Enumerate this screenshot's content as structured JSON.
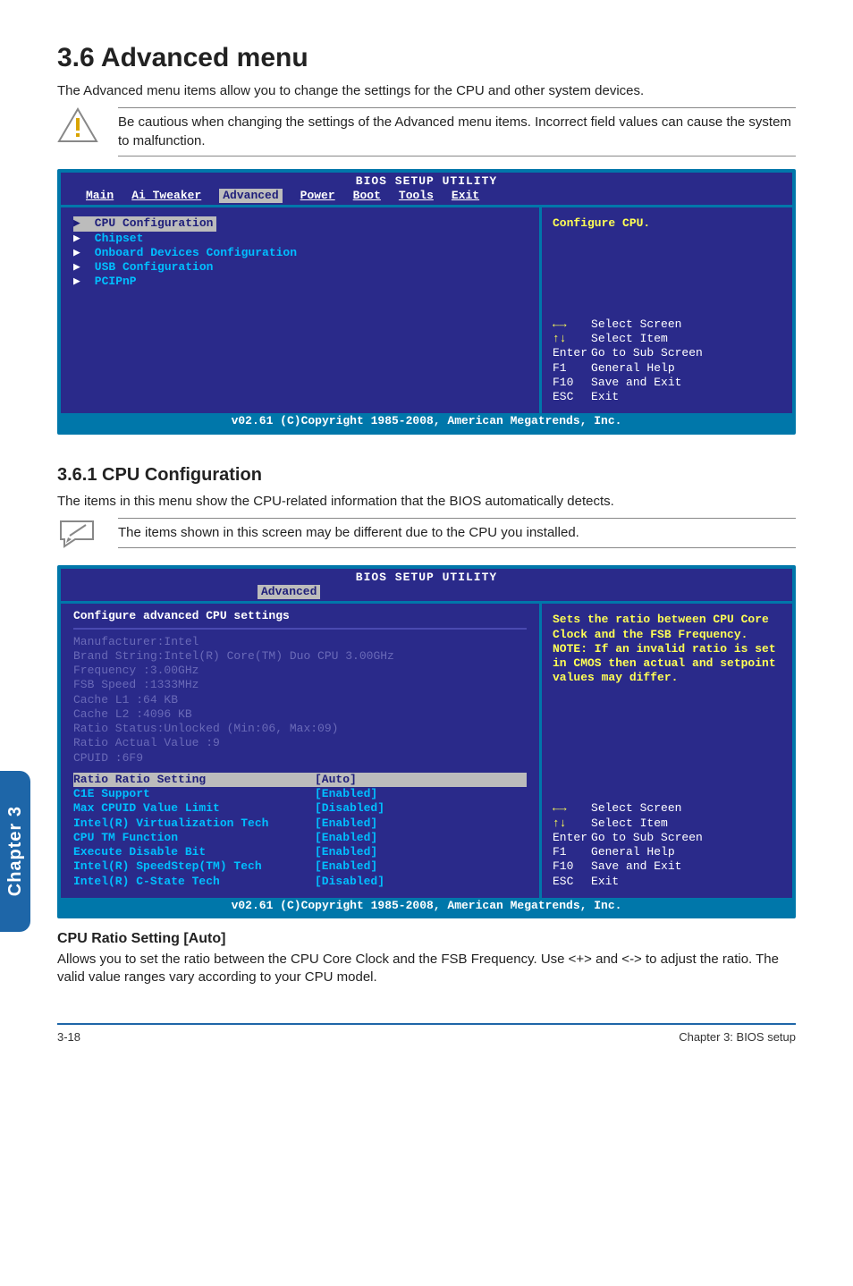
{
  "heading": {
    "number_title": "3.6     Advanced menu",
    "intro": "The Advanced menu items allow you to change the settings for the CPU and other system devices.",
    "caution": "Be cautious when changing the settings of the Advanced menu items. Incorrect field values can cause the system to malfunction."
  },
  "bios1": {
    "title": "BIOS SETUP UTILITY",
    "tabs": [
      "Main",
      "Ai Tweaker",
      "Advanced",
      "Power",
      "Boot",
      "Tools",
      "Exit"
    ],
    "active_tab_index": 2,
    "menu": [
      "CPU Configuration",
      "Chipset",
      "Onboard Devices Configuration",
      "USB Configuration",
      "PCIPnP"
    ],
    "highlighted_index": 0,
    "right_top": "Configure CPU.",
    "help": [
      {
        "key": "←→",
        "label": "Select Screen"
      },
      {
        "key": "↑↓",
        "label": "Select Item"
      },
      {
        "key": "Enter",
        "label": "Go to Sub Screen"
      },
      {
        "key": "F1",
        "label": "General Help"
      },
      {
        "key": "F10",
        "label": "Save and Exit"
      },
      {
        "key": "ESC",
        "label": "Exit"
      }
    ],
    "footer": "v02.61 (C)Copyright 1985-2008, American Megatrends, Inc."
  },
  "subsection": {
    "number_title": "3.6.1      CPU Configuration",
    "intro": "The items in this menu show the CPU-related information that the BIOS automatically detects.",
    "note": "The items shown in this screen may be different due to the CPU you installed."
  },
  "bios2": {
    "title": "BIOS SETUP UTILITY",
    "active_tab": "Advanced",
    "panel_title": "Configure advanced CPU settings",
    "info_lines": [
      "Manufacturer:Intel",
      "Brand String:Intel(R) Core(TM) Duo CPU 3.00GHz",
      "Frequency   :3.00GHz",
      "FSB Speed   :1333MHz",
      "Cache L1    :64 KB",
      "Cache L2    :4096 KB",
      "Ratio Status:Unlocked (Min:06, Max:09)",
      "Ratio Actual Value :9",
      "CPUID       :6F9"
    ],
    "settings": [
      {
        "name": "Ratio Ratio Setting",
        "value": "[Auto]",
        "hi": true
      },
      {
        "name": "C1E Support",
        "value": "[Enabled]"
      },
      {
        "name": "Max CPUID Value Limit",
        "value": "[Disabled]"
      },
      {
        "name": "Intel(R) Virtualization Tech",
        "value": "[Enabled]"
      },
      {
        "name": "CPU TM Function",
        "value": "[Enabled]"
      },
      {
        "name": "Execute Disable Bit",
        "value": "[Enabled]"
      },
      {
        "name": "Intel(R) SpeedStep(TM) Tech",
        "value": "[Enabled]"
      },
      {
        "name": "Intel(R) C-State Tech",
        "value": "[Disabled]"
      }
    ],
    "right_top": "Sets the ratio between CPU Core Clock and the FSB Frequency.\nNOTE: If an invalid ratio is set in CMOS then actual and setpoint values may differ.",
    "help": [
      {
        "key": "←→",
        "label": "Select Screen"
      },
      {
        "key": "↑↓",
        "label": "Select Item"
      },
      {
        "key": "Enter",
        "label": "Go to Sub Screen"
      },
      {
        "key": "F1",
        "label": "General Help"
      },
      {
        "key": "F10",
        "label": "Save and Exit"
      },
      {
        "key": "ESC",
        "label": "Exit"
      }
    ],
    "footer": "v02.61 (C)Copyright 1985-2008, American Megatrends, Inc."
  },
  "cpu_ratio": {
    "title": "CPU Ratio Setting [Auto]",
    "body": "Allows you to set the ratio between the CPU Core Clock and the FSB Frequency. Use <+> and <-> to adjust the ratio. The valid value ranges vary according to your CPU model."
  },
  "chapter_tab": "Chapter 3",
  "footer": {
    "left": "3-18",
    "right": "Chapter 3: BIOS setup"
  }
}
